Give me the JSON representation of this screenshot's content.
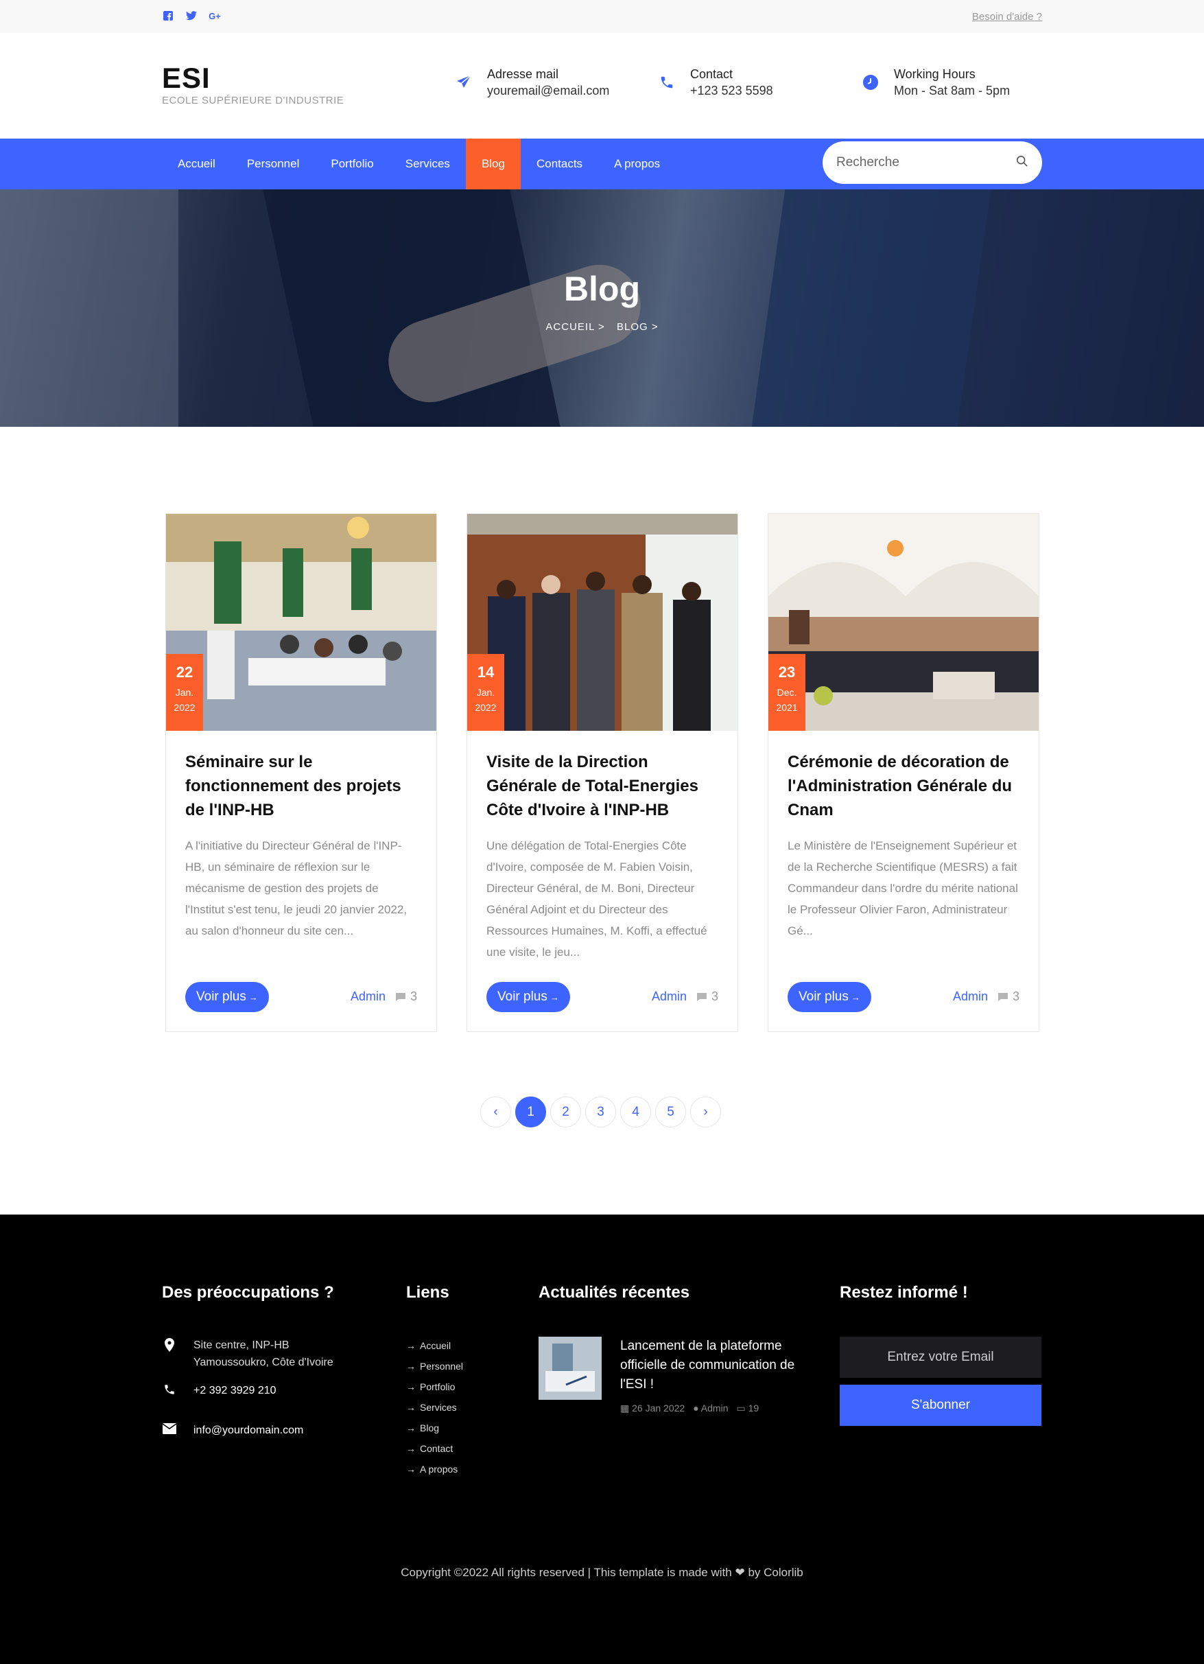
{
  "topbar": {
    "social": [
      "facebook-icon",
      "twitter-icon",
      "google-plus-icon"
    ],
    "help_link": "Besoin d'aide ?"
  },
  "header": {
    "logo_title": "ESI",
    "logo_subtitle": "ECOLE SUPÉRIEURE D'INDUSTRIE",
    "info": [
      {
        "icon": "paper-plane-icon",
        "line1": "Adresse mail",
        "line2": "youremail@email.com"
      },
      {
        "icon": "phone-icon",
        "line1": "Contact",
        "line2": "+123 523 5598"
      },
      {
        "icon": "clock-icon",
        "line1": "Working Hours",
        "line2": "Mon - Sat 8am - 5pm"
      }
    ]
  },
  "nav": {
    "items": [
      "Accueil",
      "Personnel",
      "Portfolio",
      "Services",
      "Blog",
      "Contacts",
      "A propos"
    ],
    "active": "Blog",
    "search_placeholder": "Recherche"
  },
  "hero": {
    "title": "Blog",
    "breadcrumb": [
      "ACCUEIL >",
      "BLOG >"
    ]
  },
  "posts": [
    {
      "day": "22",
      "month": "Jan.",
      "year": "2022",
      "title": "Séminaire sur le fonctionnement des projets de l'INP-HB",
      "excerpt": "A l'initiative du Directeur Général de l'INP-HB, un séminaire de réflexion sur le mécanisme de gestion des projets de l'Institut s'est tenu, le jeudi 20 janvier 2022, au salon d'honneur du site cen...",
      "button": "Voir plus",
      "author": "Admin",
      "comments": "3"
    },
    {
      "day": "14",
      "month": "Jan.",
      "year": "2022",
      "title": "Visite de la Direction Générale de Total-Energies Côte d'Ivoire à l'INP-HB",
      "excerpt": "Une délégation de Total-Energies Côte d'Ivoire, composée de M. Fabien Voisin, Directeur Général, de M. Boni, Directeur Général Adjoint et du Directeur des Ressources Humaines, M. Koffi, a effectué une visite, le jeu...",
      "button": "Voir plus",
      "author": "Admin",
      "comments": "3"
    },
    {
      "day": "23",
      "month": "Dec.",
      "year": "2021",
      "title": "Cérémonie de décoration de l'Administration Générale du Cnam",
      "excerpt": "Le Ministère de l'Enseignement Supérieur et de la Recherche Scientifique (MESRS) a fait Commandeur dans l'ordre du mérite national le Professeur Olivier Faron, Administrateur Gé...",
      "button": "Voir plus",
      "author": "Admin",
      "comments": "3"
    }
  ],
  "pagination": {
    "prev": "‹",
    "pages": [
      "1",
      "2",
      "3",
      "4",
      "5"
    ],
    "current": "1",
    "next": "›"
  },
  "footer": {
    "col1": {
      "heading": "Des préoccupations ?",
      "address": "Site centre, INP-HB Yamoussoukro, Côte d'Ivoire",
      "phone": "+2 392 3929 210",
      "email": "info@yourdomain.com"
    },
    "col2": {
      "heading": "Liens",
      "links": [
        "Accueil",
        "Personnel",
        "Portfolio",
        "Services",
        "Blog",
        "Contact",
        "A propos"
      ]
    },
    "col3": {
      "heading": "Actualités récentes",
      "news_title": "Lancement de la plateforme officielle de communication de l'ESI !",
      "news_date": "26 Jan 2022",
      "news_author": "Admin",
      "news_comments": "19"
    },
    "col4": {
      "heading": "Restez informé !",
      "email_placeholder": "Entrez votre Email",
      "button": "S'abonner"
    },
    "copyright_prefix": "Copyright ©2022 All rights reserved | This template is made with",
    "copyright_suffix": "by Colorlib"
  },
  "colors": {
    "primary": "#3e64ff",
    "accent": "#fd5f2a",
    "footer_bg": "#000000"
  }
}
